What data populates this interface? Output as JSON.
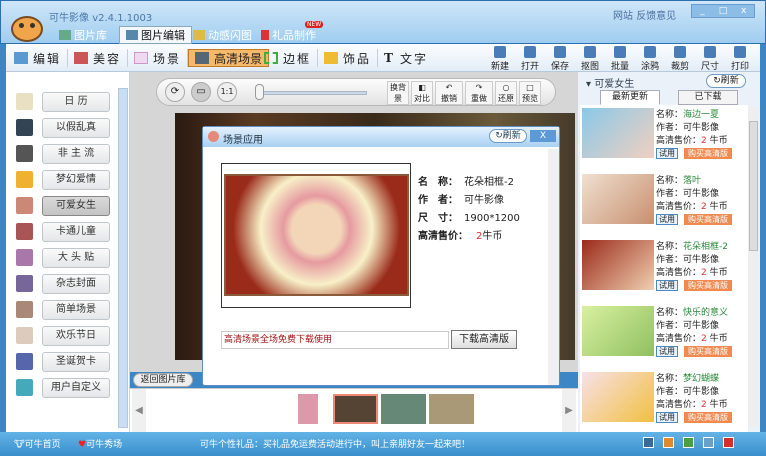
{
  "app": {
    "title": "可牛影像",
    "version": "v2.4.1.1003",
    "links": [
      "网站",
      "反馈意见"
    ],
    "window_buttons": [
      "_",
      "□",
      "x"
    ]
  },
  "main_tabs": [
    {
      "label": "图片库"
    },
    {
      "label": "图片编辑"
    },
    {
      "label": "动感闪图"
    },
    {
      "label": "礼品制作",
      "badge": "NEW"
    }
  ],
  "tools": [
    "编辑",
    "美容",
    "场景",
    "高清场景",
    "边框",
    "饰品",
    "文字"
  ],
  "right_tools": [
    "新建",
    "打开",
    "保存",
    "抠图",
    "批量",
    "涂鸦",
    "裁剪",
    "尺寸",
    "打印"
  ],
  "categories": [
    "日 历",
    "以假乱真",
    "非 主 流",
    "梦幻爱情",
    "可爱女生",
    "卡通儿童",
    "大 头 贴",
    "杂志封面",
    "简单场景",
    "欢乐节日",
    "圣诞贺卡",
    "用户自定义"
  ],
  "canvas_tools": {
    "zoom_label": "1:1",
    "buttons": [
      "换背景",
      "对比",
      "撤销",
      "重做",
      "还原",
      "预览"
    ]
  },
  "dialog": {
    "title": "场景应用",
    "refresh": "刷新",
    "close": "X",
    "info": [
      {
        "label": "名　称：",
        "value": "花朵相框-2"
      },
      {
        "label": "作　者：",
        "value": "可牛影像"
      },
      {
        "label": "尺　寸：",
        "value": "1900*1200"
      },
      {
        "label": "高清售价：",
        "value": "2",
        "unit": "牛币"
      }
    ],
    "notice": "高清场景全场免费下载使用",
    "download": "下载高清版"
  },
  "back_button": "返回图片库",
  "right_panel": {
    "category": "可爱女生",
    "refresh": "刷新",
    "tabs": [
      "最新更新",
      "已下载"
    ],
    "labels": {
      "name": "名称：",
      "author": "作者：",
      "price": "高清售价：",
      "unit": " 牛币",
      "try": "试用",
      "buy": "购买高清版"
    },
    "items": [
      {
        "name": "海边一夏",
        "author": "可牛影像",
        "price": "2"
      },
      {
        "name": "落叶",
        "author": "可牛影像",
        "price": "2"
      },
      {
        "name": "花朵相框-2",
        "author": "可牛影像",
        "price": "2"
      },
      {
        "name": "快乐的意义",
        "author": "可牛影像",
        "price": "2"
      },
      {
        "name": "梦幻蝴蝶",
        "author": "可牛影像",
        "price": "2"
      }
    ]
  },
  "status": {
    "home": "可牛首页",
    "show": "可牛秀场",
    "message": "可牛个性礼品：买礼品免运费活动进行中，叫上亲朋好友一起来吧！"
  }
}
